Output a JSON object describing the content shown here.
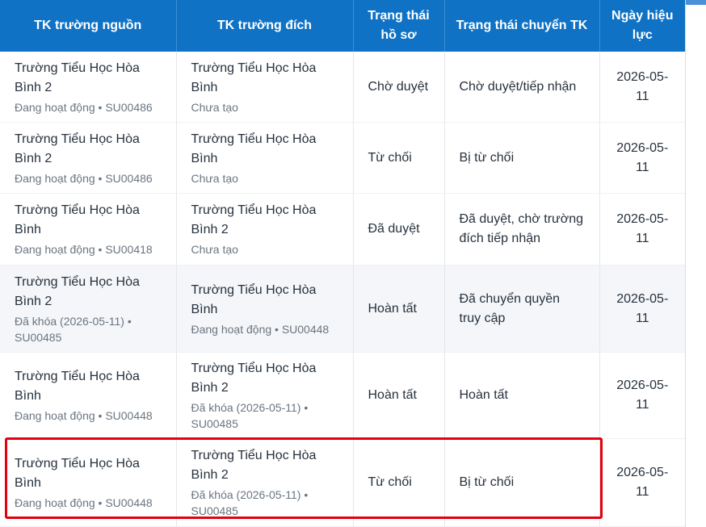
{
  "table": {
    "headers": [
      "TK trường nguồn",
      "TK trường đích",
      "Trạng thái hồ sơ",
      "Trạng thái chuyển TK",
      "Ngày hiệu lực"
    ],
    "rows": [
      {
        "source_name": "Trường Tiểu Học Hòa Bình 2",
        "source_status": "Đang hoạt động • SU00486",
        "dest_name": "Trường Tiểu Học Hòa Bình",
        "dest_status": "Chưa tạo",
        "record_status": "Chờ duyệt",
        "transfer_status": "Chờ duyệt/tiếp nhận",
        "effective_date": "2026-05-11"
      },
      {
        "source_name": "Trường Tiểu Học Hòa Bình 2",
        "source_status": "Đang hoạt động • SU00486",
        "dest_name": "Trường Tiểu Học Hòa Bình",
        "dest_status": "Chưa tạo",
        "record_status": "Từ chối",
        "transfer_status": "Bị từ chối",
        "effective_date": "2026-05-11"
      },
      {
        "source_name": "Trường Tiểu Học Hòa Bình",
        "source_status": "Đang hoạt động • SU00418",
        "dest_name": "Trường Tiểu Học Hòa Bình 2",
        "dest_status": "Chưa tạo",
        "record_status": "Đã duyệt",
        "transfer_status": "Đã duyệt, chờ trường đích tiếp nhận",
        "effective_date": "2026-05-11"
      },
      {
        "source_name": "Trường Tiểu Học Hòa Bình 2",
        "source_status": "Đã khóa (2026-05-11) • SU00485",
        "dest_name": "Trường Tiểu Học Hòa Bình",
        "dest_status": "Đang hoạt động • SU00448",
        "record_status": "Hoàn tất",
        "transfer_status": "Đã chuyển quyền truy cập",
        "effective_date": "2026-05-11"
      },
      {
        "source_name": "Trường Tiểu Học Hòa Bình",
        "source_status": "Đang hoạt động • SU00448",
        "dest_name": "Trường Tiểu Học Hòa Bình 2",
        "dest_status": "Đã khóa (2026-05-11) • SU00485",
        "record_status": "Hoàn tất",
        "transfer_status": "Hoàn tất",
        "effective_date": "2026-05-11"
      },
      {
        "source_name": "Trường Tiểu Học Hòa Bình",
        "source_status": "Đang hoạt động • SU00448",
        "dest_name": "Trường Tiểu Học Hòa Bình 2",
        "dest_status": "Đã khóa (2026-05-11) • SU00485",
        "record_status": "Từ chối",
        "transfer_status": "Bị từ chối",
        "effective_date": "2026-05-11"
      }
    ]
  },
  "colors": {
    "header_bg": "#0f72c4",
    "highlight_border": "#e3000f",
    "alt_row_bg": "#f4f6f9"
  }
}
